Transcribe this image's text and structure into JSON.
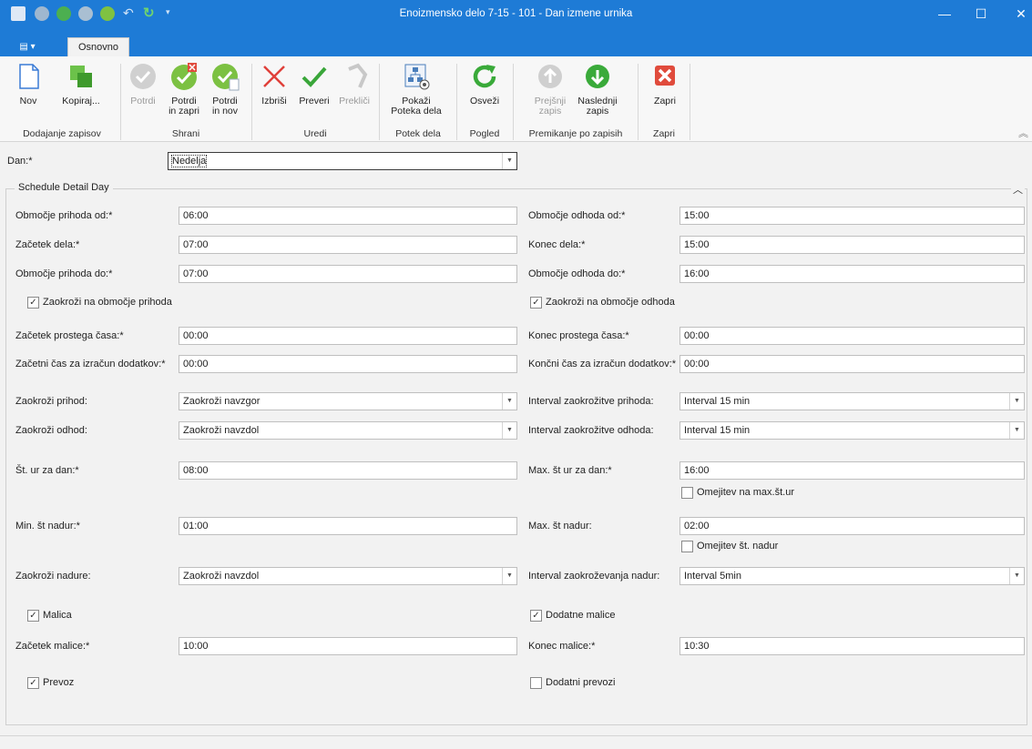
{
  "window": {
    "title": "Enoizmensko delo 7-15 - 101 - Dan izmene urnika",
    "minimize": "—",
    "maximize": "☐",
    "close": "✕"
  },
  "qat_icons": [
    "app-icon",
    "gear-icon",
    "add-icon",
    "confirm-icon",
    "confirm-new-icon",
    "undo-icon",
    "refresh-icon",
    "customize-icon"
  ],
  "tabs": {
    "app_menu": "▤ ▾",
    "home": "Osnovno"
  },
  "ribbon": {
    "new": "Nov",
    "copy": "Kopiraj...",
    "confirm": "Potrdi",
    "confirm_close_1": "Potrdi",
    "confirm_close_2": "in zapri",
    "confirm_new_1": "Potrdi",
    "confirm_new_2": "in nov",
    "delete": "Izbriši",
    "check": "Preveri",
    "cancel": "Prekliči",
    "show_flow_1": "Pokaži",
    "show_flow_2": "Poteka dela",
    "refresh": "Osveži",
    "prev_1": "Prejšnji",
    "prev_2": "zapis",
    "next_1": "Naslednji",
    "next_2": "zapis",
    "close": "Zapri",
    "groups": {
      "add": "Dodajanje zapisov",
      "save": "Shrani",
      "edit": "Uredi",
      "workflow": "Potek dela",
      "view": "Pogled",
      "nav": "Premikanje po zapisih",
      "close": "Zapri"
    },
    "collapse": "︽"
  },
  "form": {
    "day_label": "Dan:*",
    "day_value": "Nedelja",
    "group_title": "Schedule Detail Day",
    "group_collapse": "︿",
    "arrival_from_label": "Območje prihoda od:*",
    "arrival_from": "06:00",
    "departure_from_label": "Območje odhoda od:*",
    "departure_from": "15:00",
    "work_start_label": "Začetek dela:*",
    "work_start": "07:00",
    "work_end_label": "Konec dela:*",
    "work_end": "15:00",
    "arrival_to_label": "Območje prihoda do:*",
    "arrival_to": "07:00",
    "departure_to_label": "Območje odhoda do:*",
    "departure_to": "16:00",
    "round_arrival_label": "Zaokroži na območje prihoda",
    "round_arrival_checked": true,
    "round_departure_label": "Zaokroži na območje odhoda",
    "round_departure_checked": true,
    "idle_start_label": "Začetek prostega časa:*",
    "idle_start": "00:00",
    "idle_end_label": "Konec prostega časa:*",
    "idle_end": "00:00",
    "bonus_start_label": "Začetni čas za izračun dodatkov:*",
    "bonus_start": "00:00",
    "bonus_end_label": "Končni čas za izračun dodatkov:*",
    "bonus_end": "00:00",
    "round_in_label": "Zaokroži prihod:",
    "round_in": "Zaokroži navzgor",
    "round_in_interval_label": "Interval zaokrožitve prihoda:",
    "round_in_interval": "Interval 15 min",
    "round_out_label": "Zaokroži odhod:",
    "round_out": "Zaokroži navzdol",
    "round_out_interval_label": "Interval zaokrožitve odhoda:",
    "round_out_interval": "Interval 15 min",
    "hours_day_label": "Št. ur za dan:*",
    "hours_day": "08:00",
    "max_hours_day_label": "Max. št ur za dan:*",
    "max_hours_day": "16:00",
    "limit_max_hours_label": "Omejitev na max.št.ur",
    "limit_max_hours_checked": false,
    "min_overtime_label": "Min. št nadur:*",
    "min_overtime": "01:00",
    "max_overtime_label": "Max. št nadur:",
    "max_overtime": "02:00",
    "limit_overtime_label": "Omejitev št. nadur",
    "limit_overtime_checked": false,
    "round_overtime_label": "Zaokroži nadure:",
    "round_overtime": "Zaokroži navzdol",
    "overtime_interval_label": "Interval zaokroževanja nadur:",
    "overtime_interval": "Interval 5min",
    "meal_label": "Malica",
    "meal_checked": true,
    "extra_meals_label": "Dodatne malice",
    "extra_meals_checked": true,
    "meal_start_label": "Začetek malice:*",
    "meal_start": "10:00",
    "meal_end_label": "Konec malice:*",
    "meal_end": "10:30",
    "transport_label": "Prevoz",
    "transport_checked": true,
    "extra_transport_label": "Dodatni prevozi",
    "extra_transport_checked": false
  }
}
